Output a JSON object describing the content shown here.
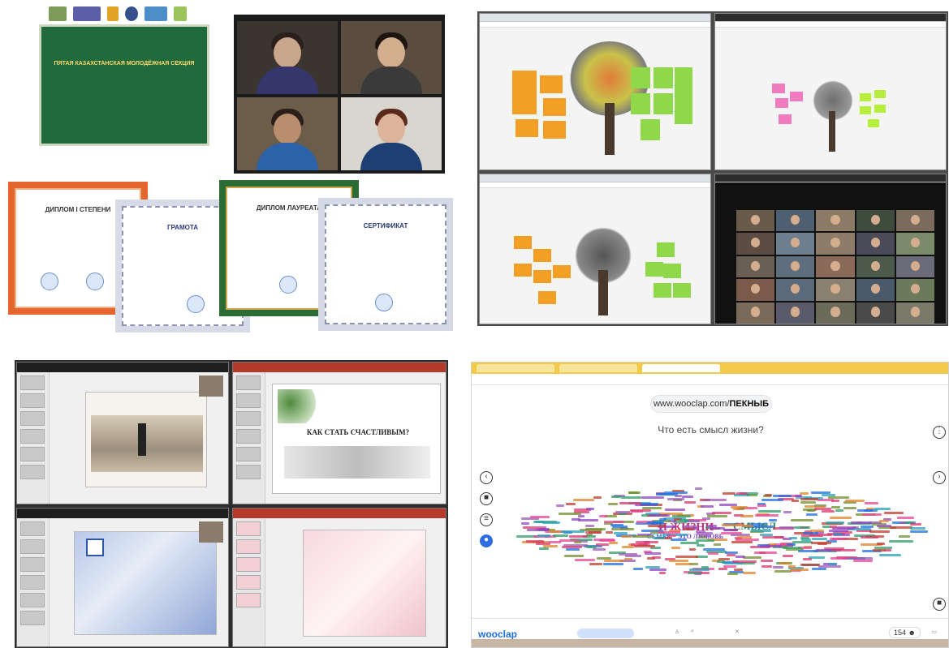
{
  "q1": {
    "green_card": {
      "title": "ПЯТАЯ КАЗАХСТАНСКАЯ МОЛОДЁЖНАЯ СЕКЦИЯ"
    },
    "certificates": [
      {
        "title": "ДИПЛОМ I СТЕПЕНИ"
      },
      {
        "title": "ГРАМОТА"
      },
      {
        "title": "ДИПЛОМ ЛАУРЕАТА"
      },
      {
        "title": "СЕРТИФИКАТ"
      }
    ]
  },
  "q2": {},
  "q3": {
    "slides": [
      {
        "title": ""
      },
      {
        "title": "КАК СТАТЬ СЧАСТЛИВЫМ?"
      },
      {
        "title": ""
      },
      {
        "title": ""
      }
    ]
  },
  "q4": {
    "url_prefix": "www.wooclap.com/",
    "url_code": "ПЕКНЫБ",
    "question": "Что есть смысл жизни?",
    "brand": "wooclap",
    "participants": "154",
    "cloud_words": [
      "И ЖИЗНИ",
      "СМЫСЛ",
      "СЕМЬЯ",
      "ЭТО ЛЮБОВЬ"
    ],
    "colors": {
      "accent": "#1e6fe0",
      "chrome_tabs": "#f3c94a"
    }
  }
}
